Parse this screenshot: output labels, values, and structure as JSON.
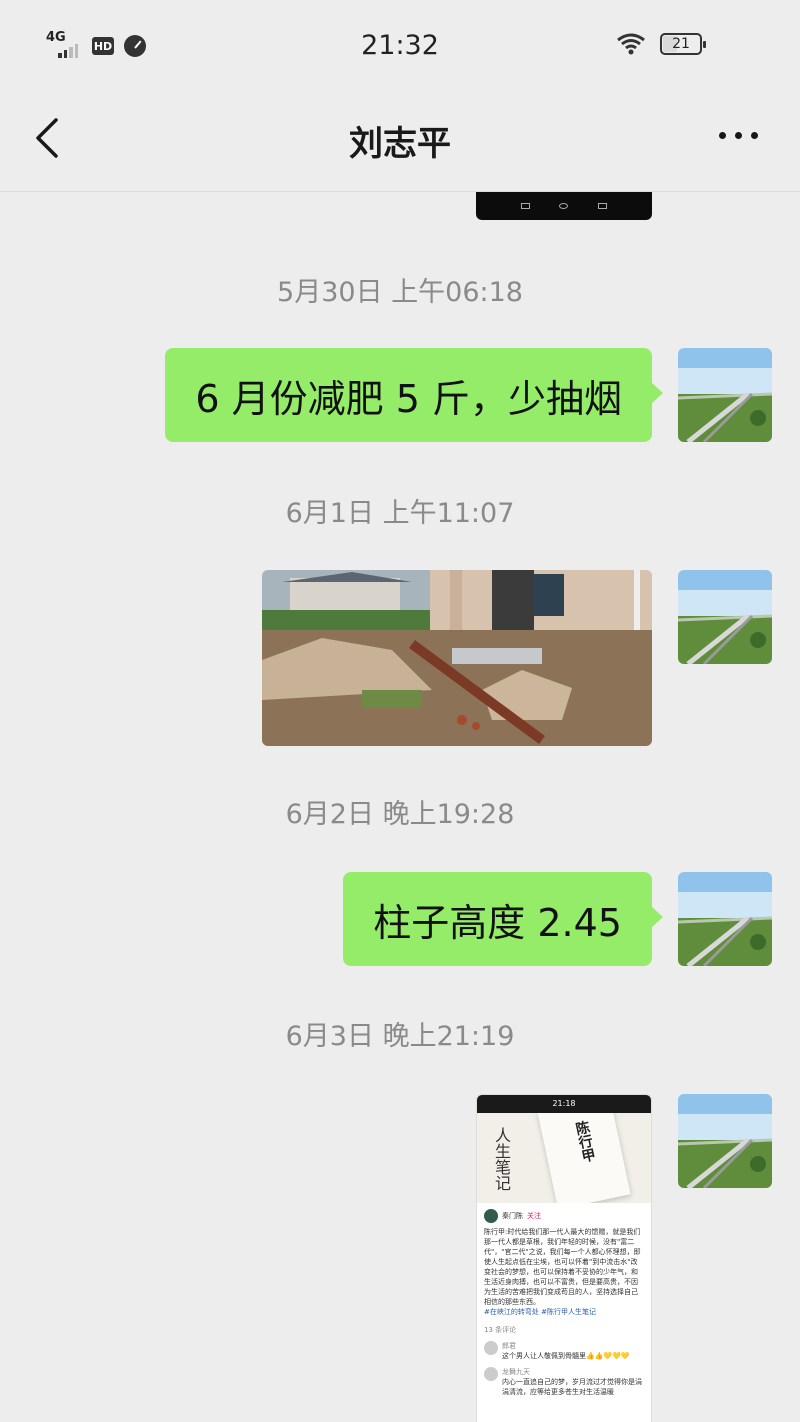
{
  "status_bar": {
    "network": "4G",
    "hd": "HD",
    "time": "21:32",
    "battery": "21",
    "battery_level": 0.21
  },
  "header": {
    "title": "刘志平"
  },
  "messages": [
    {
      "type": "timestamp",
      "text": "5月30日 上午06:18"
    },
    {
      "type": "text",
      "from": "me",
      "text": "6 月份减肥 5 斤，少抽烟"
    },
    {
      "type": "timestamp",
      "text": "6月1日 上午11:07"
    },
    {
      "type": "image",
      "from": "me",
      "subject": "house-construction-photo"
    },
    {
      "type": "timestamp",
      "text": "6月2日 晚上19:28"
    },
    {
      "type": "text",
      "from": "me",
      "text": "柱子高度 2.45"
    },
    {
      "type": "timestamp",
      "text": "6月3日 晚上21:19"
    },
    {
      "type": "image",
      "from": "me",
      "subject": "app-screenshot"
    }
  ],
  "screenshot": {
    "time": "21:18",
    "cover_title": "陈行甲",
    "cover_sub": "人生笔记",
    "author": "秦门陈",
    "follow": "关注",
    "body": "陈行甲:时代给我们那一代人最大的馈赠，就是我们那一代人都是草根，我们年轻的时候，没有\"富二代\"，\"官二代\"之说，我们每一个人都心怀理想，即使人生起点低在尘埃，也可以怀着\"到中流击水\"改变社会的梦想，也可以保持着不妥协的少年气，和生活近身肉搏，也可以不富贵，但是要高贵，不因为生活的苦难把我们变成苟且的人，坚持选择自己相信的那些东西。",
    "tags": "#在峡江的转弯处 #陈行甲人生笔记",
    "comment_count": "13 条评论",
    "comments": [
      {
        "name": "郎君",
        "text": "这个男人让人敬佩到骨髓里👍👍💛💛💛"
      },
      {
        "name": "龙舞九天",
        "text": "内心一直追自己的梦，岁月流过才觉得你是涓涓清流，应等给更多苍生对生活温暖"
      }
    ]
  }
}
